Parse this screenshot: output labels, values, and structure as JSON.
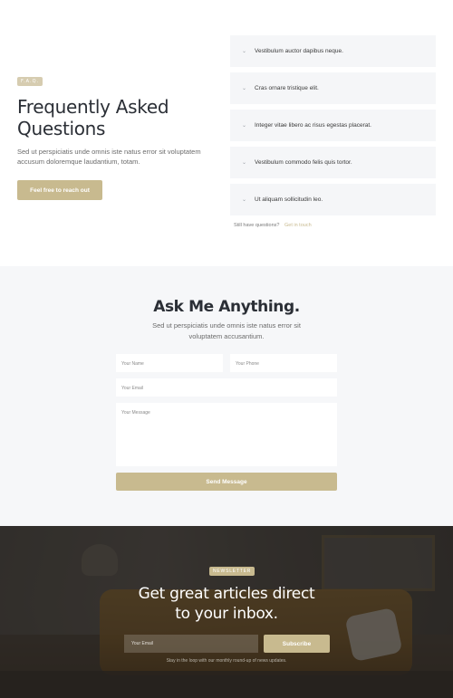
{
  "faq": {
    "badge": "F.A.Q.",
    "title": "Frequently Asked Questions",
    "description": "Sed ut perspiciatis unde omnis iste natus error sit voluptatem accusum doloremque laudantium, totam.",
    "cta_label": "Feel free to reach out",
    "items": [
      {
        "question": "Vestibulum auctor dapibus neque."
      },
      {
        "question": "Cras ornare tristique elit."
      },
      {
        "question": "Integer vitae libero ac risus egestas placerat."
      },
      {
        "question": "Vestibulum commodo felis quis tortor."
      },
      {
        "question": "Ut aliquam sollicitudin leo."
      }
    ],
    "footer_text": "Still have questions?",
    "footer_link": "Get in touch",
    "accent_color": "#c8ba8f"
  },
  "contact": {
    "title": "Ask Me Anything.",
    "description": "Sed ut perspiciatis unde omnis iste natus error sit voluptatem accusantium.",
    "name_placeholder": "Your Name",
    "phone_placeholder": "Your Phone",
    "email_placeholder": "Your Email",
    "message_placeholder": "Your Message",
    "submit_label": "Send Message"
  },
  "newsletter": {
    "badge": "NEWSLETTER",
    "title_line1": "Get great articles direct",
    "title_line2": "to your inbox.",
    "email_placeholder": "Your Email",
    "subscribe_label": "Subscribe",
    "note": "Stay in the loop with our monthly round-up of news updates."
  }
}
